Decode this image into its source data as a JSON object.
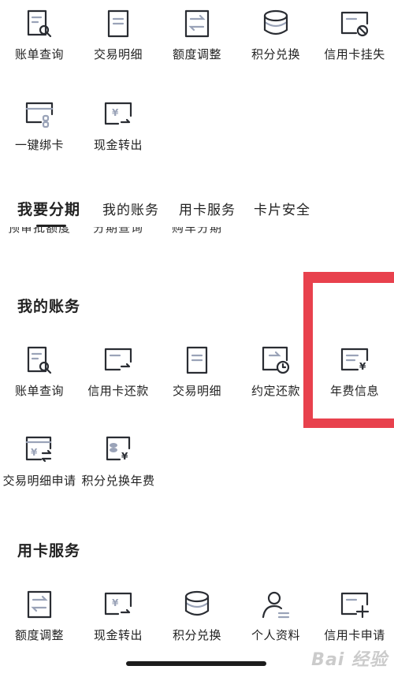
{
  "top_grid": {
    "row1": [
      {
        "label": "账单查询",
        "icon": "bill-search-icon"
      },
      {
        "label": "交易明细",
        "icon": "transaction-list-icon"
      },
      {
        "label": "额度调整",
        "icon": "limit-adjust-icon"
      },
      {
        "label": "积分兑换",
        "icon": "points-coins-icon"
      },
      {
        "label": "信用卡挂失",
        "icon": "card-lost-icon"
      }
    ],
    "row2": [
      {
        "label": "一键绑卡",
        "icon": "card-bind-icon"
      },
      {
        "label": "现金转出",
        "icon": "cash-out-icon"
      }
    ]
  },
  "tabs": [
    {
      "label": "我要分期",
      "active": true
    },
    {
      "label": "我的账务",
      "active": false
    },
    {
      "label": "用卡服务",
      "active": false
    },
    {
      "label": "卡片安全",
      "active": false
    }
  ],
  "ghost_row": [
    "预审批额度",
    "分期查询",
    "购车分期"
  ],
  "section_my_account": {
    "title": "我的账务",
    "row1": [
      {
        "label": "账单查询",
        "icon": "bill-search-icon"
      },
      {
        "label": "信用卡还款",
        "icon": "card-repay-icon"
      },
      {
        "label": "交易明细",
        "icon": "transaction-list-icon"
      },
      {
        "label": "约定还款",
        "icon": "scheduled-repay-icon"
      },
      {
        "label": "年费信息",
        "icon": "annual-fee-icon"
      }
    ],
    "row2": [
      {
        "label": "交易明细申请",
        "icon": "statement-request-icon"
      },
      {
        "label": "积分兑换年费",
        "icon": "points-fee-icon"
      }
    ]
  },
  "section_card_service": {
    "title": "用卡服务",
    "row1": [
      {
        "label": "额度调整",
        "icon": "limit-adjust-icon"
      },
      {
        "label": "现金转出",
        "icon": "cash-out-icon"
      },
      {
        "label": "积分兑换",
        "icon": "points-coins-icon"
      },
      {
        "label": "个人资料",
        "icon": "profile-icon"
      },
      {
        "label": "信用卡申请",
        "icon": "card-apply-icon"
      }
    ]
  },
  "colors": {
    "highlight": "#e8414d",
    "icon_dark": "#2a2d33",
    "icon_accent": "#9aa3b8"
  },
  "watermark": "Bai 经验"
}
